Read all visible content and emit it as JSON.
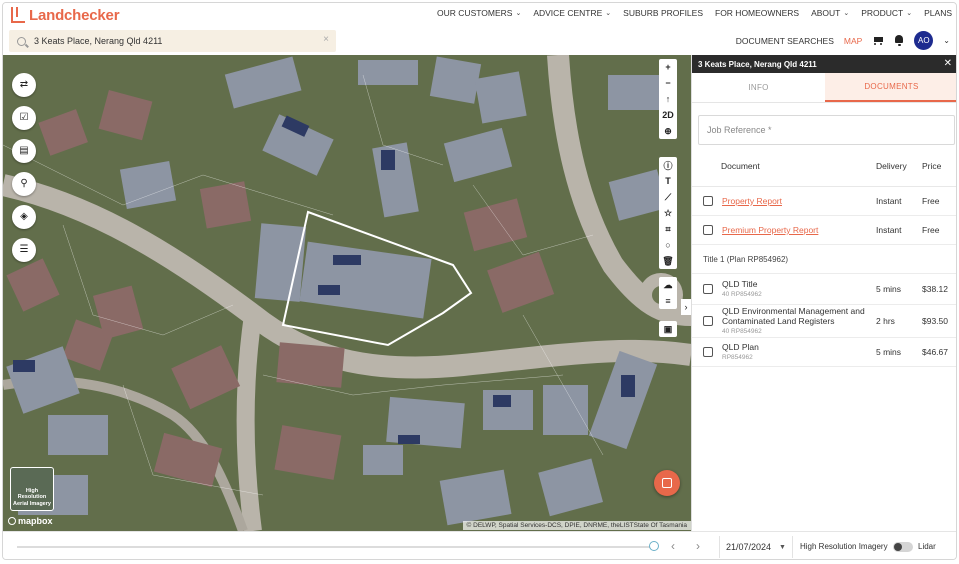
{
  "brand": {
    "name": "Landchecker",
    "accent": "#e8684a"
  },
  "nav": {
    "items": [
      {
        "label": "OUR CUSTOMERS",
        "dropdown": true
      },
      {
        "label": "ADVICE CENTRE",
        "dropdown": true
      },
      {
        "label": "SUBURB PROFILES",
        "dropdown": false
      },
      {
        "label": "FOR HOMEOWNERS",
        "dropdown": false
      },
      {
        "label": "ABOUT",
        "dropdown": true
      },
      {
        "label": "PRODUCT",
        "dropdown": true
      },
      {
        "label": "PLANS",
        "dropdown": false
      }
    ]
  },
  "search": {
    "value": "3 Keats Place, Nerang Qld 4211",
    "clear": "×"
  },
  "subnav": {
    "document_searches": "DOCUMENT SEARCHES",
    "map": "MAP",
    "avatar_initials": "AO"
  },
  "map": {
    "left_tools": [
      "route-icon",
      "checkbox-icon",
      "clipboard-icon",
      "pin-icon",
      "layers-icon",
      "list-icon"
    ],
    "zoom_in": "+",
    "zoom_out": "−",
    "compass": "↑",
    "view_mode": "2D",
    "hires_label": "High Resolution Aerial Imagery",
    "mapbox_label": "mapbox",
    "attribution": "© DELWP, Spatial Services-DCS, DPIE, DNRME, theLISTState Of Tasmania"
  },
  "timeline": {
    "date": "21/07/2024",
    "high_res_label": "High Resolution Imagery",
    "lidar_label": "Lidar",
    "position": 1.0
  },
  "panel": {
    "title": "3 Keats Place, Nerang Qld 4211",
    "tabs": [
      {
        "label": "INFO",
        "active": false
      },
      {
        "label": "DOCUMENTS",
        "active": true
      }
    ],
    "job_reference_placeholder": "Job Reference *",
    "columns": {
      "document": "Document",
      "delivery": "Delivery",
      "price": "Price"
    },
    "documents": [
      {
        "name": "Property Report",
        "sub": "",
        "delivery": "Instant",
        "price": "Free",
        "link": true
      },
      {
        "name": "Premium Property Report",
        "sub": "",
        "delivery": "Instant",
        "price": "Free",
        "link": true
      }
    ],
    "title_group": "Title 1 (Plan RP854962)",
    "title_documents": [
      {
        "name": "QLD Title",
        "sub": "40 RP854962",
        "delivery": "5 mins",
        "price": "$38.12"
      },
      {
        "name": "QLD Environmental Management and Contaminated Land Registers",
        "sub": "40 RP854962",
        "delivery": "2 hrs",
        "price": "$93.50"
      },
      {
        "name": "QLD Plan",
        "sub": "RP854962",
        "delivery": "5 mins",
        "price": "$46.67"
      }
    ]
  }
}
